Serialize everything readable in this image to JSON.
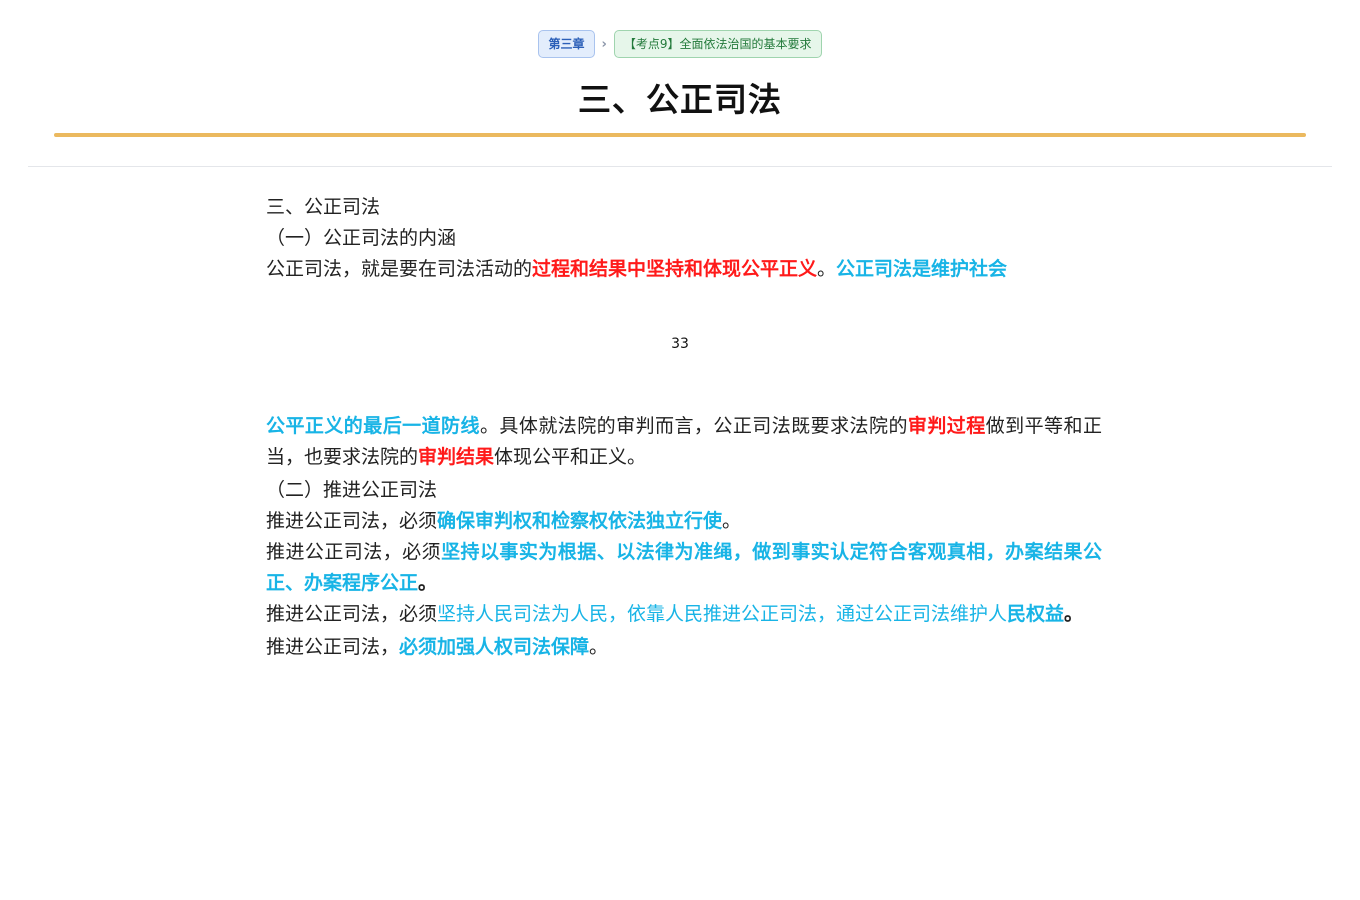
{
  "breadcrumb": {
    "chapter": "第三章",
    "separator": "›",
    "topic": "【考点9】全面依法治国的基本要求"
  },
  "page_title": "三、公正司法",
  "colors": {
    "accent_rule": "#ebb95f",
    "red_emphasis": "#ff1a1a",
    "blue_emphasis": "#18b4e6"
  },
  "content": {
    "heading": "三、公正司法",
    "sub1": "（一）公正司法的内涵",
    "p1": {
      "a": "公正司法，就是要在司法活动的",
      "b": "过程和结果中坚持和体现公平正义",
      "c": "。",
      "d": "公正司法是维护社会"
    },
    "page_number": "33",
    "p2": {
      "a": "公平正义的最后一道防线",
      "b": "。具体就法院的审判而言，公正司法既要求法院的",
      "c": "审判过程",
      "d": "做到平等和正当，也要求法院的",
      "e": "审判结果",
      "f": "体现公平和正义。"
    },
    "sub2": "（二）推进公正司法",
    "p3": {
      "a": "推进公正司法，必须",
      "b": "确保审判权和检察权依法独立行使",
      "c": "。"
    },
    "p4": {
      "a": "推进公正司法，必须",
      "b": "坚持以事实为根据、以法律为准绳，做到事实认定符合客观真相，办案结果公正、办案程序公正",
      "c": "。"
    },
    "p5": {
      "a": "推进公正司法，必须",
      "b": "坚持人民司法为人民，依靠人民推进公正司法，通过公正司法维护人",
      "c": "民权益",
      "d": "。"
    },
    "p6": {
      "a": "推进公正司法，",
      "b": "必须加强人权司法保障",
      "c": "。"
    }
  }
}
